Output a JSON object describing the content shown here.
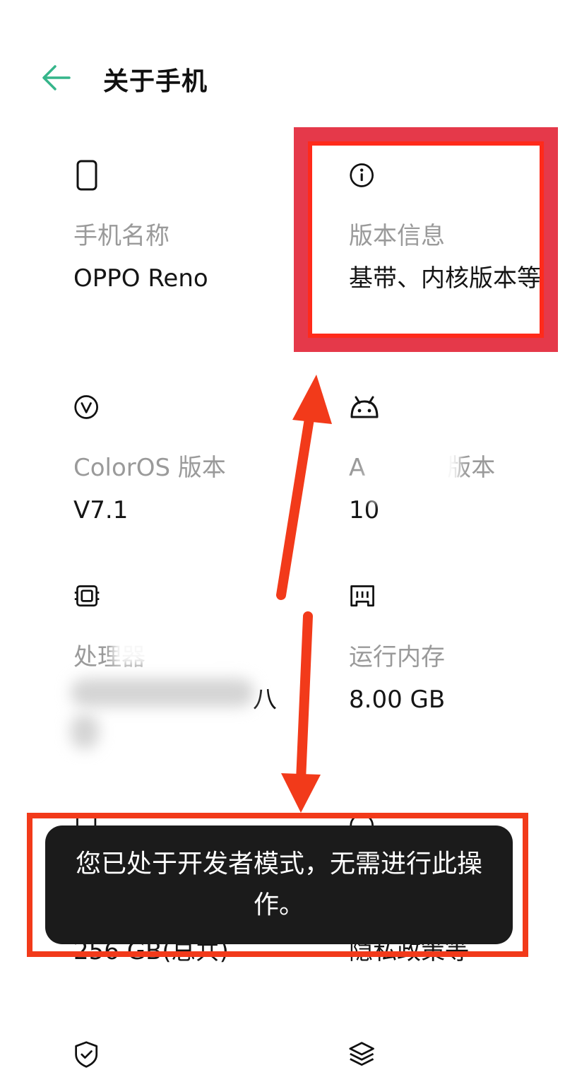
{
  "header": {
    "back_icon": "arrow-left-icon",
    "title": "关于手机",
    "accent": "#35b58a"
  },
  "cards": {
    "phone_name": {
      "icon": "phone-icon",
      "label": "手机名称",
      "value": "OPPO Reno"
    },
    "version_info": {
      "icon": "info-icon",
      "label": "版本信息",
      "value": "基带、内核版本等"
    },
    "coloros": {
      "icon": "coloros-icon",
      "label": "ColorOS 版本",
      "value": "V7.1"
    },
    "android": {
      "icon": "android-icon",
      "label_prefix": "A",
      "label_suffix": "版本",
      "value": "10"
    },
    "processor": {
      "icon": "chip-icon",
      "label": "处理器",
      "value_tail": "八"
    },
    "ram": {
      "icon": "memory-icon",
      "label": "运行内存",
      "value": "8.00 GB"
    },
    "storage": {
      "icon": "storage-icon",
      "value": "256 GB(总共)"
    },
    "legal": {
      "icon": "legal-icon",
      "value": "隐私政策等"
    },
    "security": {
      "icon": "shield-check-icon"
    },
    "layers": {
      "icon": "layers-icon"
    }
  },
  "toast": {
    "message": "您已处于开发者模式，无需进行此操作。"
  },
  "annotations": {
    "highlight_color": "#f23a1a"
  }
}
